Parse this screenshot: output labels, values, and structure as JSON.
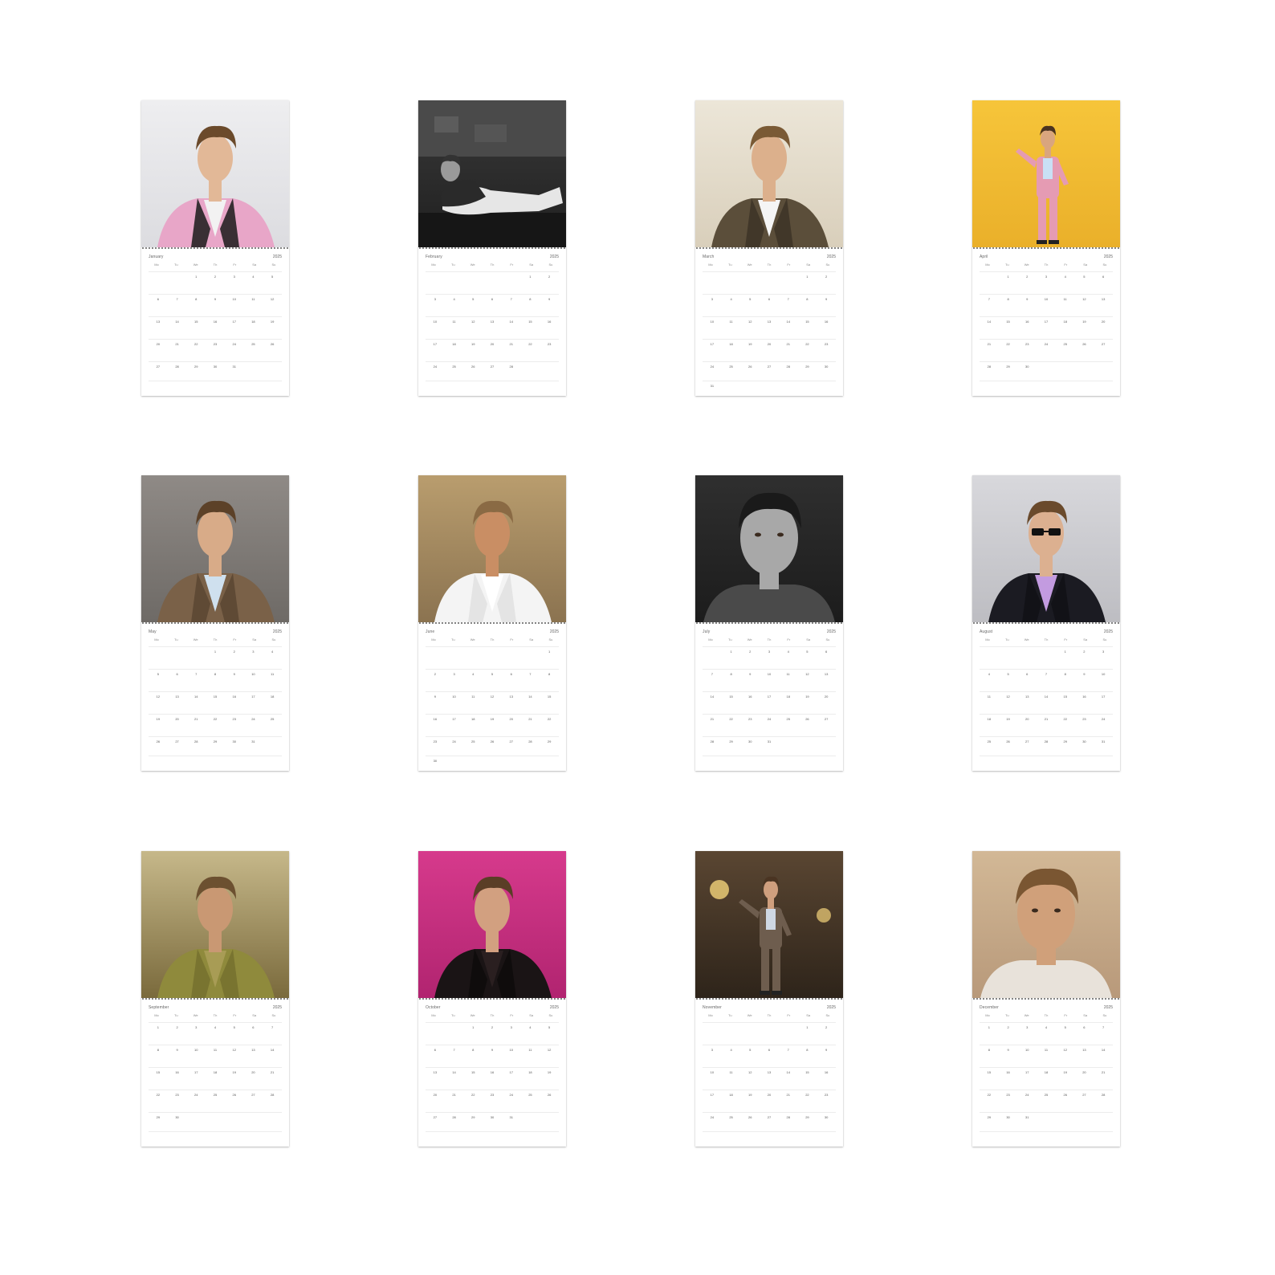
{
  "weekday_labels": [
    "Mo",
    "Tu",
    "We",
    "Th",
    "Fr",
    "Sa",
    "Su"
  ],
  "months": [
    {
      "name": "January",
      "year": "2025",
      "start": 2,
      "days": 31,
      "photo": "portrait-pink-suit"
    },
    {
      "name": "February",
      "year": "2025",
      "start": 5,
      "days": 28,
      "photo": "black-and-white-reclining"
    },
    {
      "name": "March",
      "year": "2025",
      "start": 5,
      "days": 31,
      "photo": "portrait-jacket-seated"
    },
    {
      "name": "April",
      "year": "2025",
      "start": 1,
      "days": 30,
      "photo": "full-body-pink-suit-yellow"
    },
    {
      "name": "May",
      "year": "2025",
      "start": 3,
      "days": 31,
      "photo": "portrait-plaid-blazer"
    },
    {
      "name": "June",
      "year": "2025",
      "start": 6,
      "days": 30,
      "photo": "tank-top-kitchen"
    },
    {
      "name": "July",
      "year": "2025",
      "start": 1,
      "days": 31,
      "photo": "black-and-white-closeup"
    },
    {
      "name": "August",
      "year": "2025",
      "start": 4,
      "days": 31,
      "photo": "glasses-tuxedo"
    },
    {
      "name": "September",
      "year": "2025",
      "start": 0,
      "days": 30,
      "photo": "robe-vintage-room"
    },
    {
      "name": "October",
      "year": "2025",
      "start": 2,
      "days": 31,
      "photo": "leather-jacket-magenta"
    },
    {
      "name": "November",
      "year": "2025",
      "start": 5,
      "days": 30,
      "photo": "plaid-suit-chandelier"
    },
    {
      "name": "December",
      "year": "2025",
      "start": 0,
      "days": 31,
      "photo": "closeup-harmonica"
    }
  ],
  "colors": {
    "background": "#ffffff",
    "page": "#ffffff",
    "ring": "#777777"
  }
}
